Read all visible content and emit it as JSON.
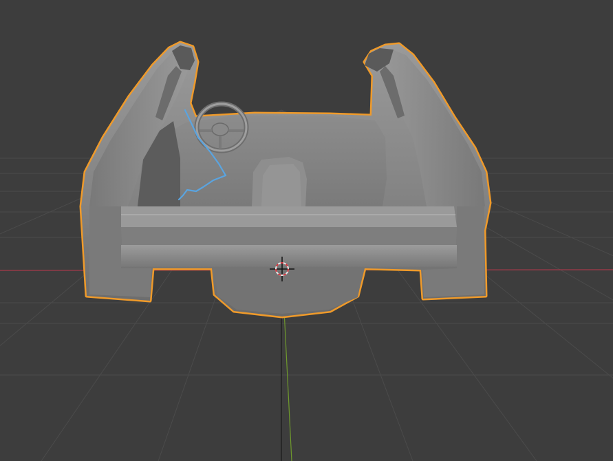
{
  "viewport": {
    "background_color": "#3d3d3d",
    "grid_color": "#4a4a4a",
    "x_axis_color": "#a8394a",
    "y_axis_color": "#6f9a2c",
    "selection_outline_color": "#ef9a2a",
    "mesh_color": "#8a8a8a",
    "curve_color": "#5aa4e0"
  },
  "scene": {
    "selected_object": "car-body-interior-mesh",
    "cursor_icon": "3d-cursor-icon",
    "curve_object": "selected-curve"
  }
}
